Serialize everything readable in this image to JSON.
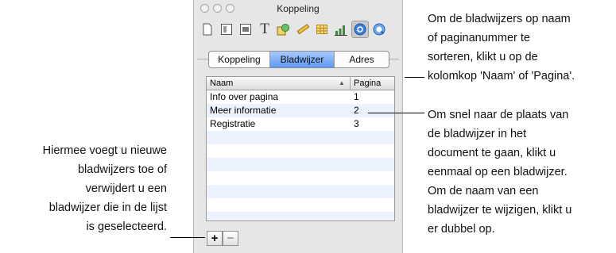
{
  "callouts": {
    "left": [
      "Hiermee voegt u nieuwe",
      "bladwijzers toe of",
      "verwijdert u een",
      "bladwijzer die in de lijst",
      "is geselecteerd."
    ],
    "right_top": [
      "Om de bladwijzers op naam",
      "of paginanummer te",
      "sorteren, klikt u op de",
      "kolomkop 'Naam' of 'Pagina'."
    ],
    "right_mid": [
      "Om snel naar de plaats van",
      "de bladwijzer in het",
      "document te gaan, klikt u",
      "eenmaal op een bladwijzer.",
      "Om de naam van een",
      "bladwijzer te wijzigen, klikt u",
      "er dubbel op."
    ]
  },
  "window": {
    "title": "Koppeling"
  },
  "toolbar": {
    "icons": [
      "document-icon",
      "layout-icon",
      "wrap-icon",
      "text-icon",
      "graphic-icon",
      "metrics-icon",
      "table-icon",
      "chart-icon",
      "link-icon",
      "quicktime-icon"
    ],
    "selected_index": 8,
    "accent": "#3b7fe0"
  },
  "tabs": [
    {
      "label": "Koppeling",
      "active": false
    },
    {
      "label": "Bladwijzer",
      "active": true
    },
    {
      "label": "Adres",
      "active": false
    }
  ],
  "table": {
    "col_name": "Naam",
    "col_page": "Pagina",
    "sort_icon": "▲",
    "rows": [
      {
        "name": "Info over pagina",
        "page": "1"
      },
      {
        "name": "Meer informatie",
        "page": "2"
      },
      {
        "name": "Registratie",
        "page": "3"
      }
    ]
  },
  "buttons": {
    "add": "+",
    "remove": "−"
  }
}
